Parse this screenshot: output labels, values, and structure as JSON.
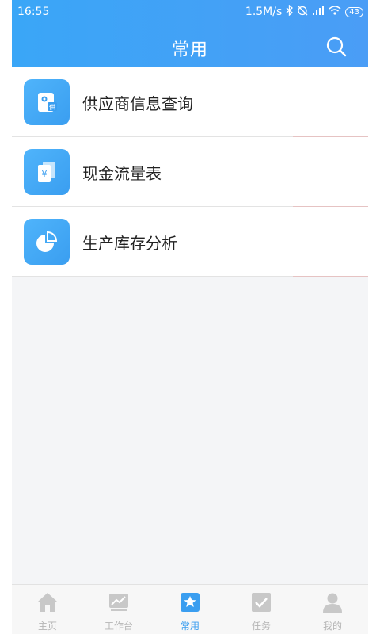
{
  "status_bar": {
    "time": "16:55",
    "speed": "1.5M/s",
    "battery": "43"
  },
  "header": {
    "title": "常用"
  },
  "items": [
    {
      "label": "供应商信息查询",
      "icon": "supplier-icon",
      "icon_text": "供"
    },
    {
      "label": "现金流量表",
      "icon": "cash-flow-icon",
      "icon_text": "¥"
    },
    {
      "label": "生产库存分析",
      "icon": "pie-chart-icon"
    }
  ],
  "tabs": [
    {
      "label": "主页",
      "icon": "home-icon",
      "active": false
    },
    {
      "label": "工作台",
      "icon": "dashboard-icon",
      "active": false
    },
    {
      "label": "常用",
      "icon": "star-icon",
      "active": true
    },
    {
      "label": "任务",
      "icon": "checkbox-icon",
      "active": false
    },
    {
      "label": "我的",
      "icon": "user-icon",
      "active": false
    }
  ],
  "colors": {
    "accent": "#3a9ef0",
    "inactive": "#b5b5b5"
  }
}
